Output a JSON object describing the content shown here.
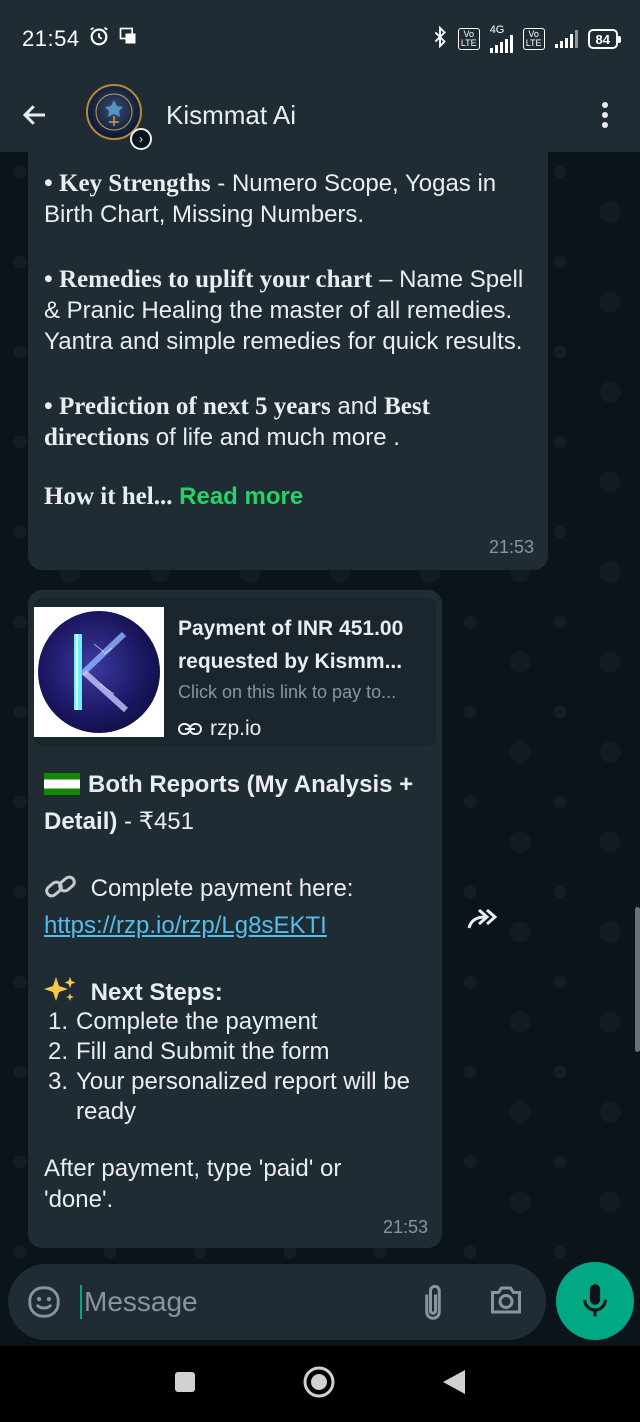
{
  "status_bar": {
    "time": "21:54",
    "battery": "84",
    "network": "4G"
  },
  "header": {
    "contact_name": "Kismmat Ai",
    "avatar_text": "Kismmat.ai"
  },
  "messages": [
    {
      "lines": [
        {
          "bold_serif": "• Key Strengths",
          "text": " - Numero Scope, Yogas in Birth Chart, Missing Numbers."
        },
        {
          "bold_serif": "• Remedies to uplift your chart",
          "text": " – Name Spell & Pranic Healing the master of all remedies. Yantra and simple remedies for quick results."
        },
        {
          "bold_serif": "• Prediction of next 5 years",
          "text_mid": " and ",
          "bold_serif_2": "Best directions",
          "text": " of life and much more ."
        }
      ],
      "truncated_text": "How it hel...",
      "read_more": "Read more",
      "timestamp": "21:53"
    },
    {
      "link_preview": {
        "title_line1": "Payment of INR 451.00",
        "title_line2": "requested by Kismm...",
        "description": "Click on this link to pay to...",
        "domain": "rzp.io"
      },
      "reports_title": "Both Reports (My Analysis + Detail)",
      "price": " - ₹451",
      "payment_prompt": "Complete payment here:",
      "payment_url": "https://rzp.io/rzp/Lg8sEKTI",
      "next_steps_title": "Next Steps:",
      "steps": [
        {
          "num": "1.",
          "text": "Complete the payment"
        },
        {
          "num": "2.",
          "text": "Fill and Submit the form"
        },
        {
          "num": "3.",
          "text": "Your personalized report will be ready"
        }
      ],
      "after_text": "After payment, type 'paid' or 'done'.",
      "timestamp": "21:53"
    }
  ],
  "input": {
    "placeholder": "Message"
  },
  "colors": {
    "accent": "#00a884",
    "read_more": "#25d366",
    "link": "#53bdeb",
    "bubble": "#1f2c34",
    "background": "#0b141a"
  }
}
